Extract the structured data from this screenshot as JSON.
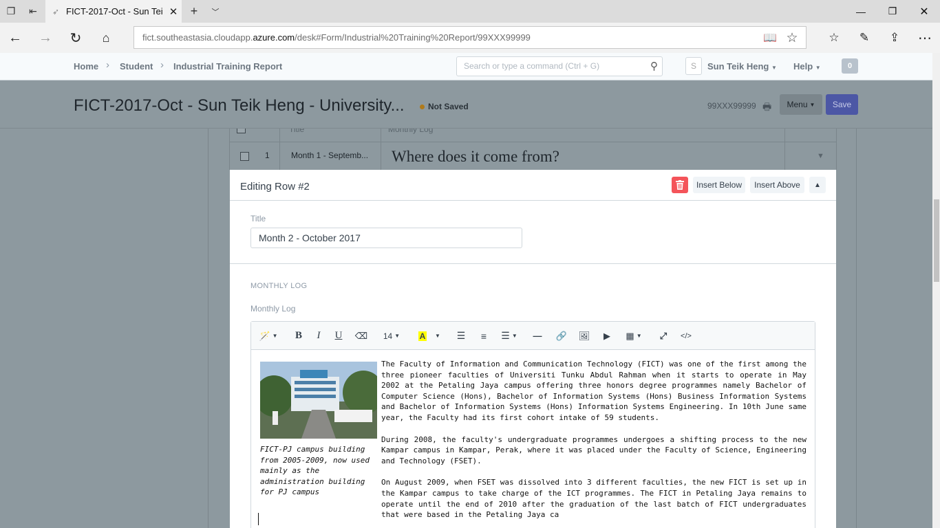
{
  "browser": {
    "tab_title": "FICT-2017-Oct - Sun Tei",
    "url_prefix": "fict.southeastasia.cloudapp.",
    "url_domain": "azure.com",
    "url_path": "/desk#Form/Industrial%20Training%20Report/99XXX99999"
  },
  "appbar": {
    "breadcrumbs": [
      "Home",
      "Student",
      "Industrial Training Report"
    ],
    "search_placeholder": "Search or type a command (Ctrl + G)",
    "avatar_letter": "S",
    "user_name": "Sun Teik Heng",
    "help_label": "Help",
    "notification_count": "0"
  },
  "page": {
    "title": "FICT-2017-Oct - Sun Teik Heng - University...",
    "status": "Not Saved",
    "doc_id": "99XXX99999",
    "menu_label": "Menu",
    "save_label": "Save"
  },
  "grid": {
    "header_title": "Title",
    "header_log": "Monthly Log",
    "row1": {
      "index": "1",
      "title": "Month 1 - Septemb...",
      "log": "Where does it come from?"
    }
  },
  "editing": {
    "heading": "Editing Row #2",
    "insert_below": "Insert Below",
    "insert_above": "Insert Above",
    "title_label": "Title",
    "title_value": "Month 2 - October 2017",
    "section_heading": "MONTHLY LOG",
    "log_label": "Monthly Log",
    "font_size": "14",
    "image_caption": "FICT-PJ campus building from 2005-2009, now used mainly as the administration building for PJ campus",
    "paragraphs": [
      "The Faculty of Information and Communication Technology (FICT) was one of the first among the three pioneer faculties of Universiti Tunku Abdul Rahman when it starts to operate in May 2002 at the Petaling Jaya campus offering three honors degree programmes namely Bachelor of Computer Science (Hons), Bachelor of Information Systems (Hons) Business Information Systems and Bachelor of Information Systems (Hons) Information Systems Engineering. In 10th June same year, the Faculty had its first cohort intake of 59 students.",
      "During 2008, the faculty's undergraduate programmes undergoes a shifting process to the new Kampar campus in Kampar, Perak, where it was placed under the Faculty of Science, Engineering and Technology (FSET).",
      "On August 2009, when FSET was dissolved into 3 different faculties, the new FICT is set up in the Kampar campus to take charge of the ICT programmes. The FICT in Petaling Jaya remains to operate until the end of 2010 after the graduation of the last batch of FICT undergraduates that were based in the Petaling Jaya ca"
    ]
  },
  "colors": {
    "primary": "#5e64ff",
    "danger": "#f4545a",
    "overlay": "#8d999f",
    "indicator_orange": "#ffa00a"
  }
}
